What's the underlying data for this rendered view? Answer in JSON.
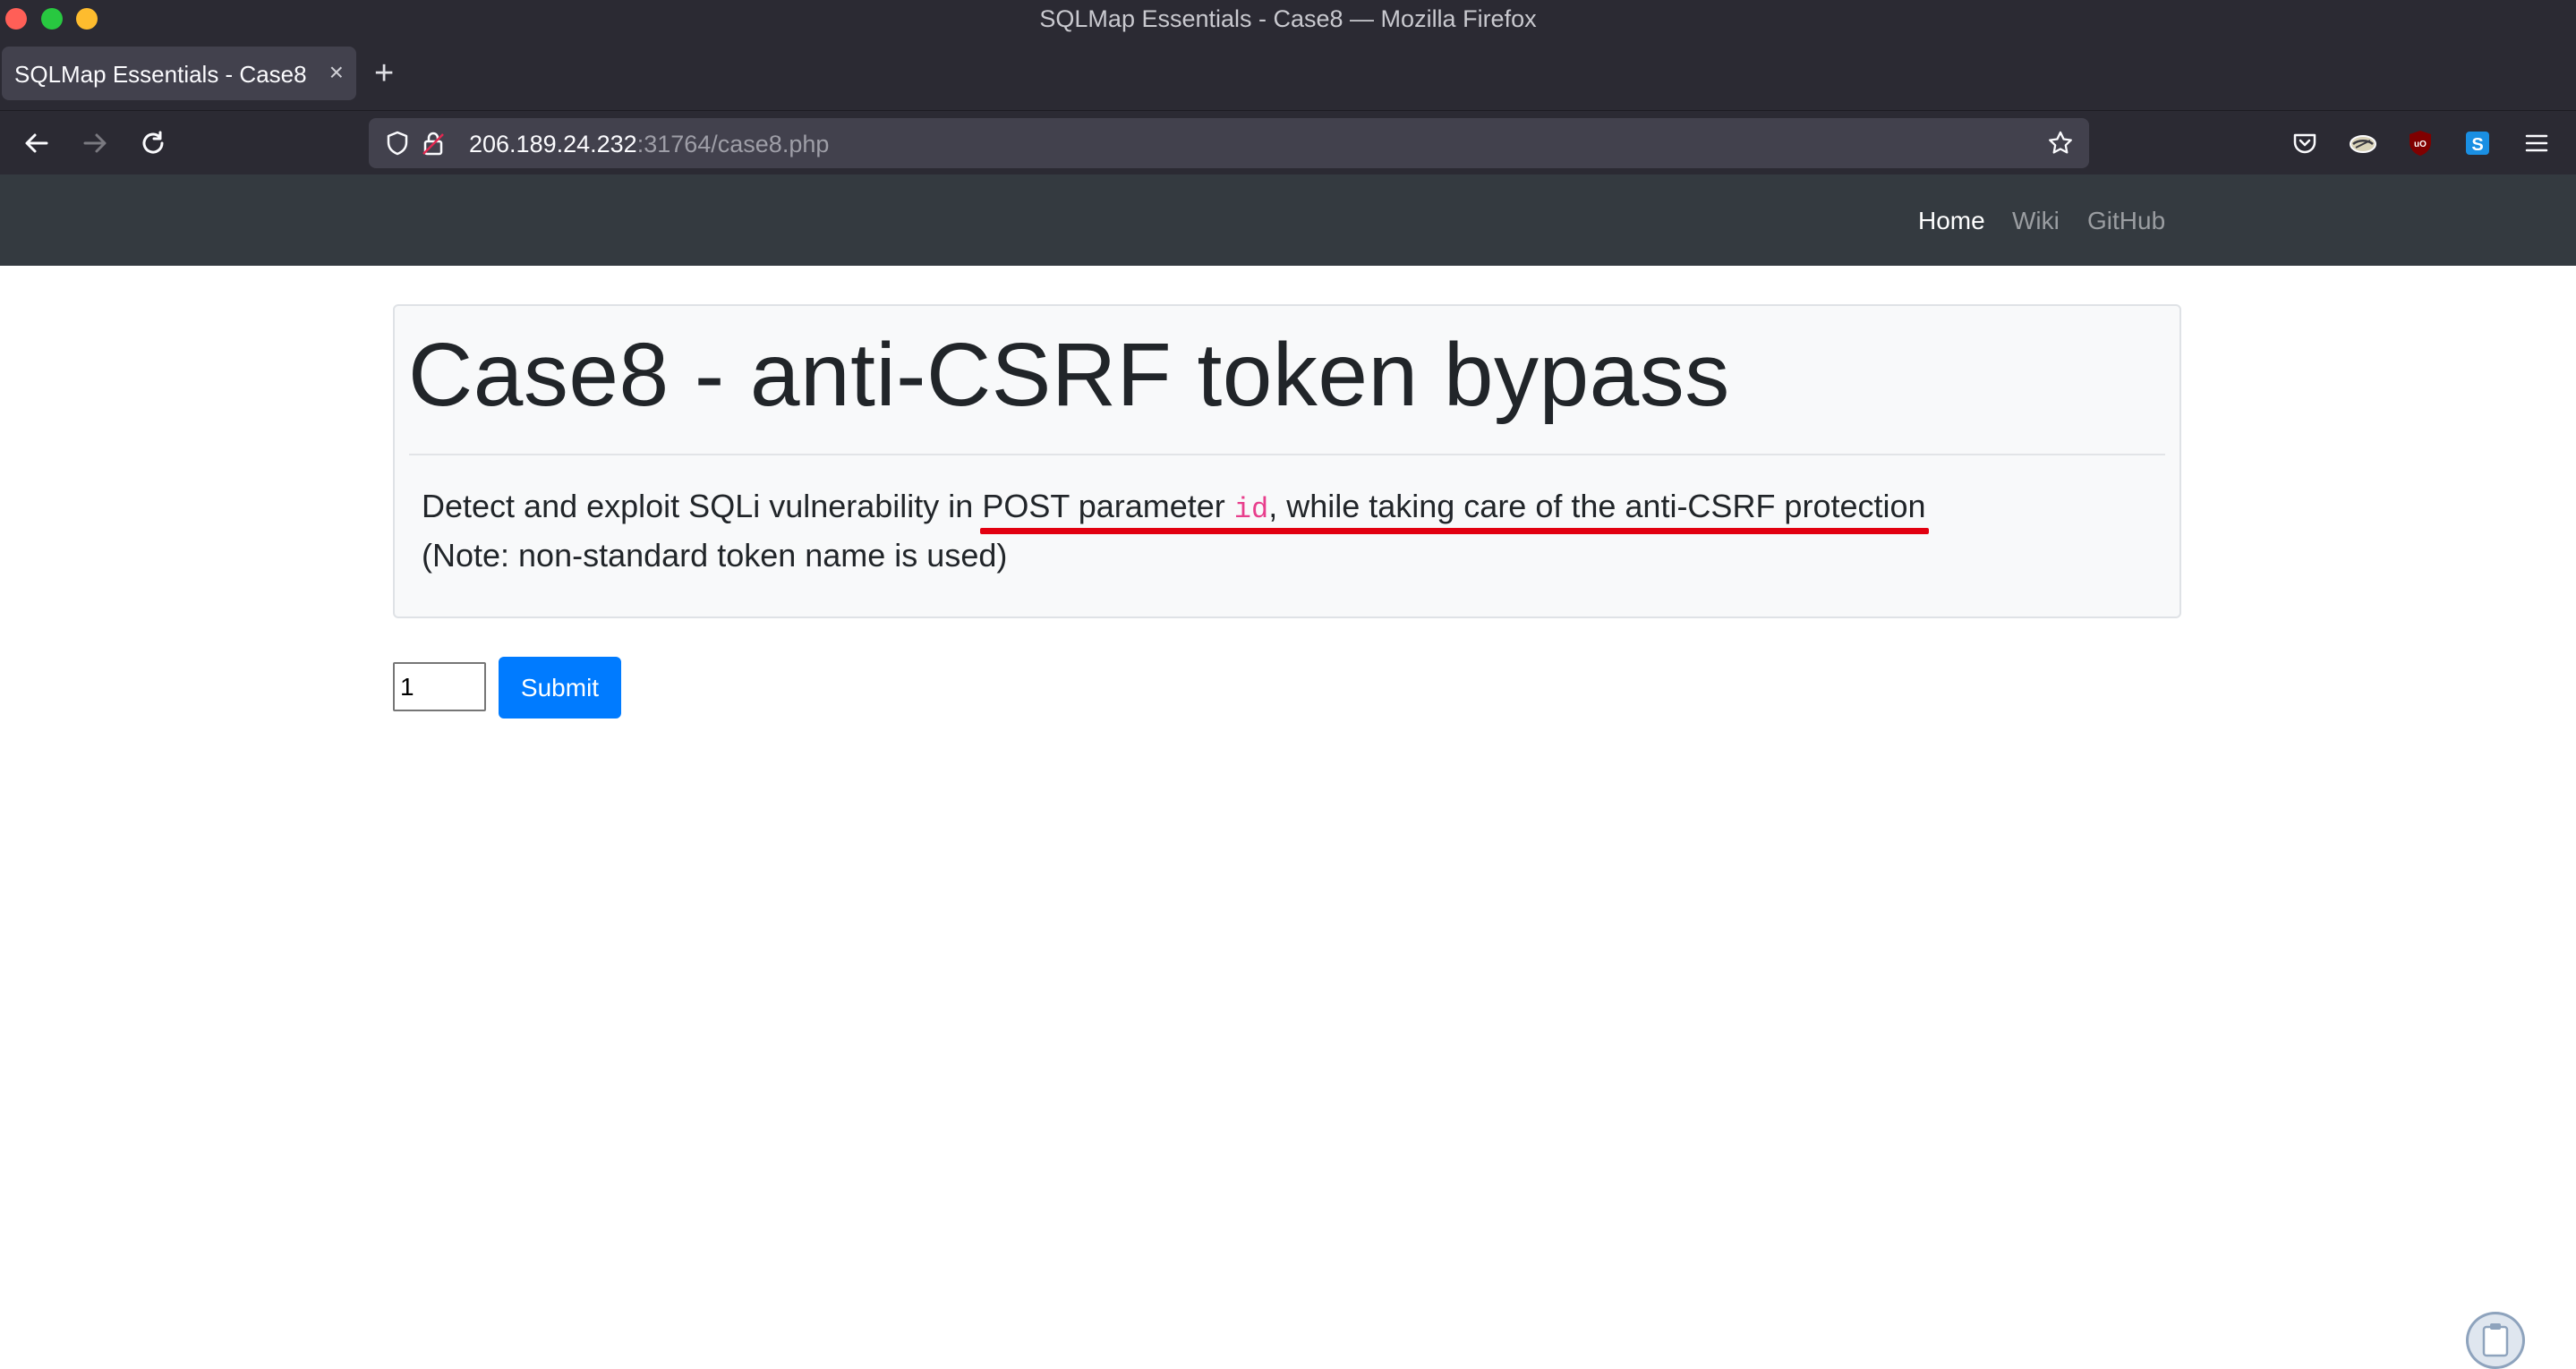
{
  "window": {
    "title": "SQLMap Essentials - Case8 — Mozilla Firefox"
  },
  "tabs": [
    {
      "title": "SQLMap Essentials - Case8",
      "close": "×"
    }
  ],
  "newtab_label": "+",
  "urlbar": {
    "host": "206.189.24.232",
    "rest": ":31764/case8.php"
  },
  "browser_icons": [
    "back-icon",
    "forward-icon",
    "reload-icon",
    "shield-icon",
    "lock-icon",
    "bookmark-star-icon",
    "pocket-icon",
    "extension-icon",
    "ublock-icon",
    "s-extension-icon",
    "menu-icon"
  ],
  "site_nav": {
    "home": "Home",
    "wiki": "Wiki",
    "github": "GitHub"
  },
  "jumbotron": {
    "title": "Case8 - anti-CSRF token bypass",
    "desc_prefix": "Detect and exploit SQLi vulnerability in ",
    "desc_highlight_a": "POST parameter ",
    "desc_code": "id",
    "desc_highlight_b": ", while taking care of the anti-CSRF protection",
    "note": "(Note: non-standard token name is used)"
  },
  "form": {
    "id_value": "1",
    "submit_label": "Submit"
  },
  "colors": {
    "accent": "#007bff",
    "navbar": "#343a40",
    "highlight": "#e20010",
    "code": "#e83e8c"
  }
}
